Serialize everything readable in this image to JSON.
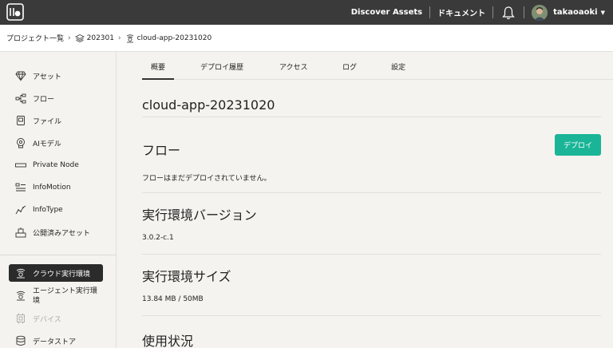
{
  "topbar": {
    "discover_assets": "Discover Assets",
    "documents": "ドキュメント",
    "username": "takaoaoki"
  },
  "breadcrumb": {
    "project_list": "プロジェクト一覧",
    "project": "202301",
    "app": "cloud-app-20231020"
  },
  "sidebar": {
    "items": [
      {
        "label": "アセット",
        "icon": "diamond-icon"
      },
      {
        "label": "フロー",
        "icon": "flow-icon"
      },
      {
        "label": "ファイル",
        "icon": "file-icon"
      },
      {
        "label": "AIモデル",
        "icon": "ai-model-icon"
      },
      {
        "label": "Private Node",
        "icon": "node-icon"
      },
      {
        "label": "InfoMotion",
        "icon": "infomotion-icon"
      },
      {
        "label": "InfoType",
        "icon": "infotype-icon"
      },
      {
        "label": "公開済みアセット",
        "icon": "published-assets-icon"
      }
    ],
    "runtime_items": [
      {
        "label": "クラウド実行環境",
        "icon": "cloud-runtime-icon"
      },
      {
        "label": "エージェント実行環境",
        "icon": "agent-runtime-icon"
      },
      {
        "label": "デバイス",
        "icon": "device-icon"
      },
      {
        "label": "データストア",
        "icon": "datastore-icon"
      }
    ]
  },
  "tabs": [
    "概要",
    "デプロイ履歴",
    "アクセス",
    "ログ",
    "設定"
  ],
  "main": {
    "app_title": "cloud-app-20231020",
    "flow_title": "フロー",
    "flow_text": "フローはまだデプロイされていません。",
    "deploy_label": "デプロイ",
    "runtime_version_title": "実行環境バージョン",
    "runtime_version_value": "3.0.2-c.1",
    "runtime_size_title": "実行環境サイズ",
    "runtime_size_value": "13.84 MB / 50MB",
    "usage_title": "使用状況"
  },
  "colors": {
    "topbar": "#3a3a3a",
    "accent": "#1ab597",
    "active_sidebar": "#2b2b2b"
  }
}
